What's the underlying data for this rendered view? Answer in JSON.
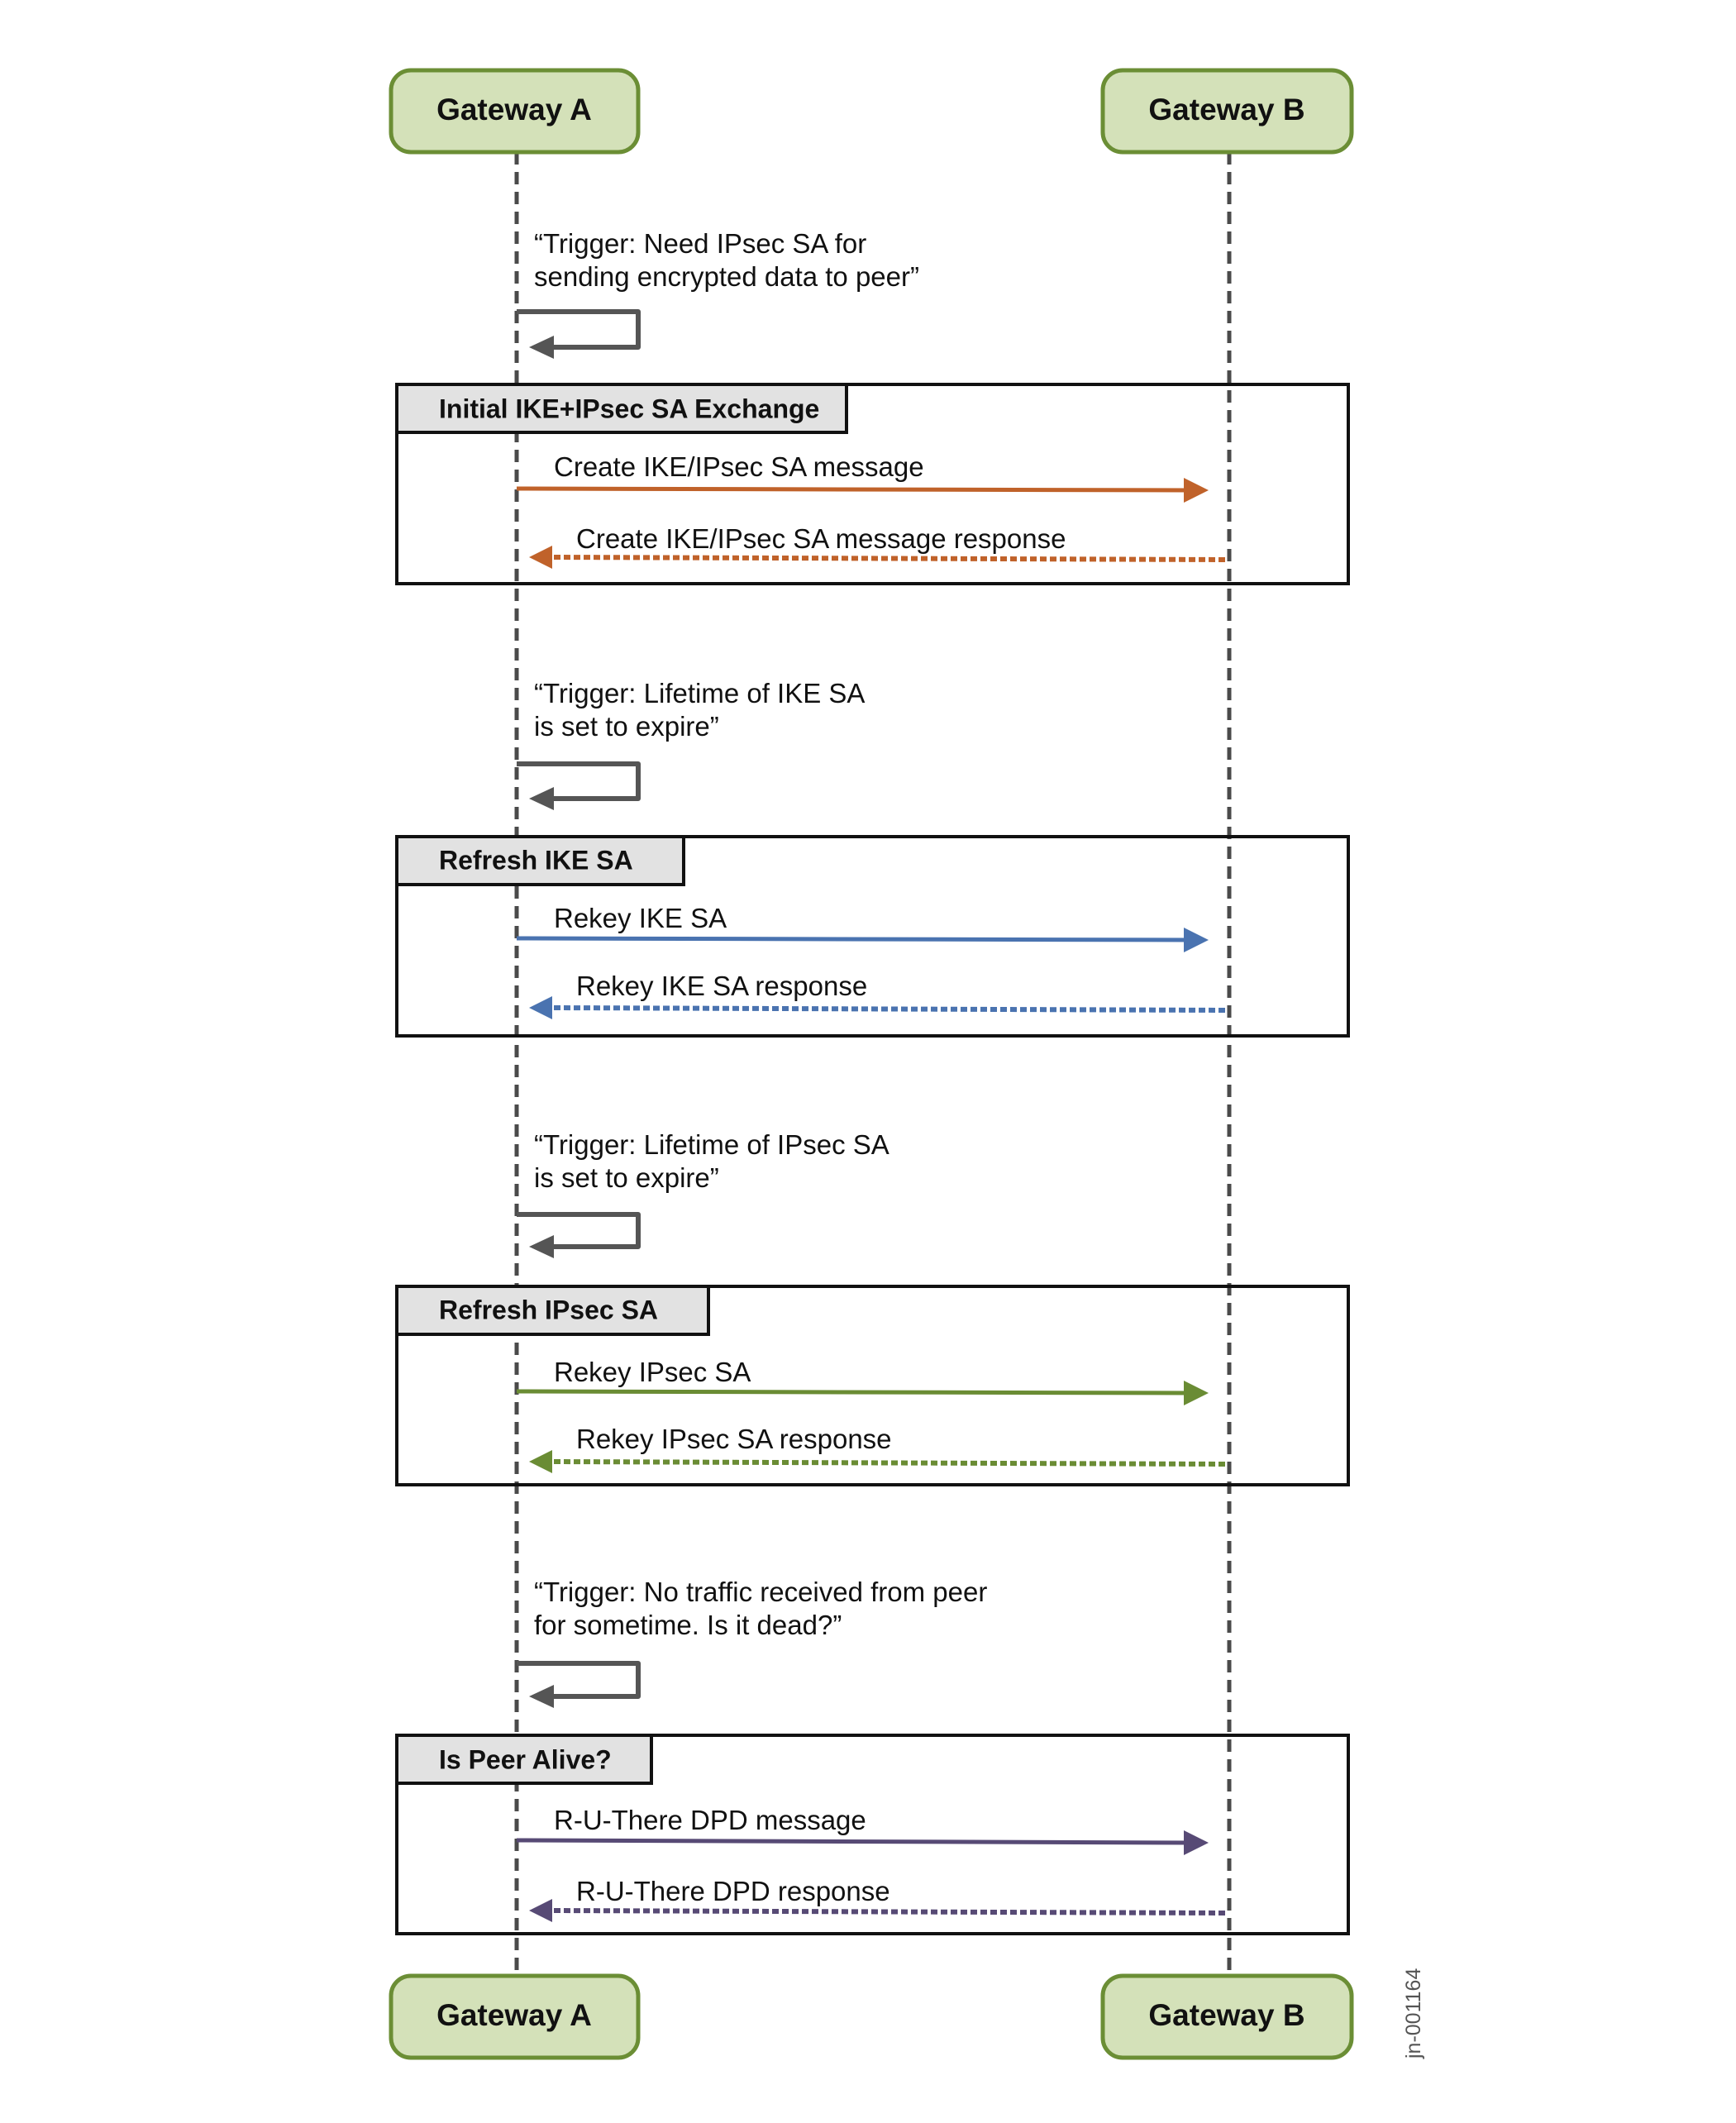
{
  "actors": {
    "a": {
      "label": "Gateway A"
    },
    "b": {
      "label": "Gateway B"
    }
  },
  "colors": {
    "actor_fill": "#d4e1b9",
    "actor_stroke": "#6b8e35",
    "lifeline": "#4a4a4a",
    "self_arrow": "#555555",
    "frame_header_fill": "#e2e2e2"
  },
  "sections": [
    {
      "trigger": [
        "“Trigger: Need IPsec SA for",
        "sending encrypted data to peer”"
      ],
      "frame_label": "Initial IKE+IPsec SA Exchange",
      "request": "Create IKE/IPsec SA message",
      "response": "Create IKE/IPsec SA message response",
      "color": "#c0622a"
    },
    {
      "trigger": [
        "“Trigger: Lifetime of IKE SA",
        "is set to expire”"
      ],
      "frame_label": "Refresh IKE SA",
      "request": "Rekey IKE SA",
      "response": "Rekey IKE SA response",
      "color": "#4a73b0"
    },
    {
      "trigger": [
        "“Trigger: Lifetime of IPsec SA",
        "is set to expire”"
      ],
      "frame_label": "Refresh IPsec SA",
      "request": "Rekey IPsec SA",
      "response": "Rekey IPsec SA response",
      "color": "#6a8c34"
    },
    {
      "trigger": [
        "“Trigger: No traffic received from peer",
        "for sometime. Is it dead?”"
      ],
      "frame_label": "Is Peer Alive?",
      "request": "R-U-There DPD message",
      "response": "R-U-There DPD response",
      "color": "#574a75"
    }
  ],
  "watermark": "jn-001164"
}
